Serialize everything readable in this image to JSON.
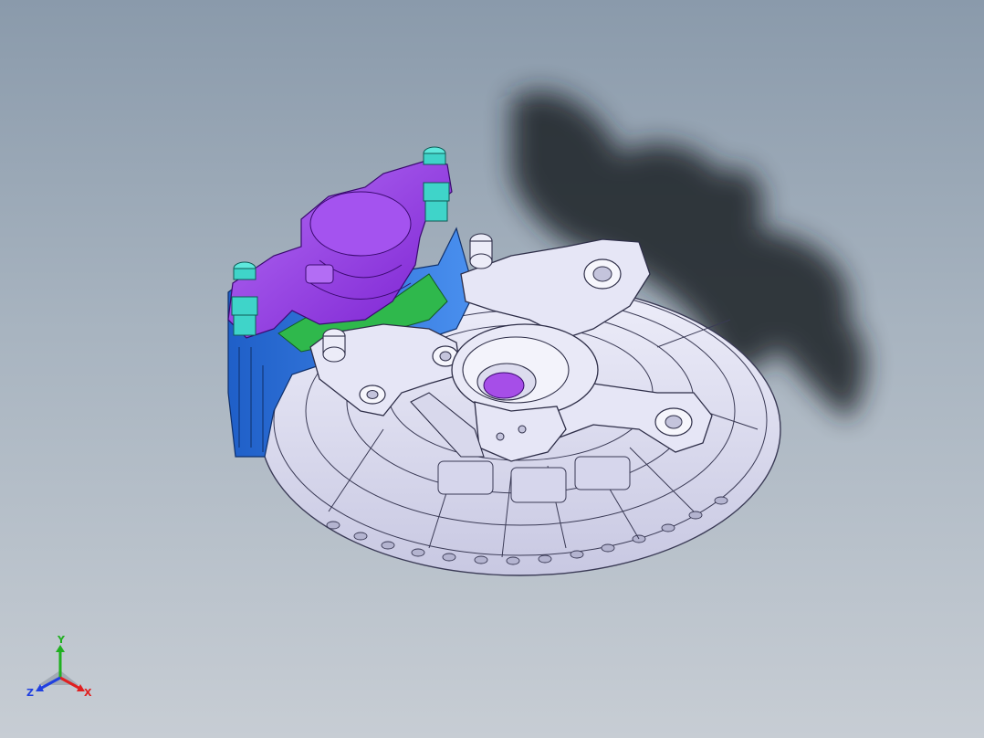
{
  "viewport": {
    "background_top": "#8a9aab",
    "background_bottom": "#c7cdd4"
  },
  "model": {
    "name": "brake-hub-assembly",
    "parts": [
      {
        "name": "brake-disc",
        "color": "#dcdcf0"
      },
      {
        "name": "steering-knuckle",
        "color": "#e4e4f4"
      },
      {
        "name": "brake-caliper",
        "color": "#9b3fe6"
      },
      {
        "name": "caliper-bracket",
        "color": "#2f6fd6"
      },
      {
        "name": "bolts",
        "color": "#3fd4c9"
      },
      {
        "name": "brake-pad",
        "color": "#2fb84c"
      },
      {
        "name": "hub-bore",
        "color": "#a64ee8"
      }
    ]
  },
  "triad": {
    "x_label": "X",
    "y_label": "Y",
    "z_label": "Z",
    "x_color": "#e02020",
    "y_color": "#20b020",
    "z_color": "#2040e0"
  }
}
